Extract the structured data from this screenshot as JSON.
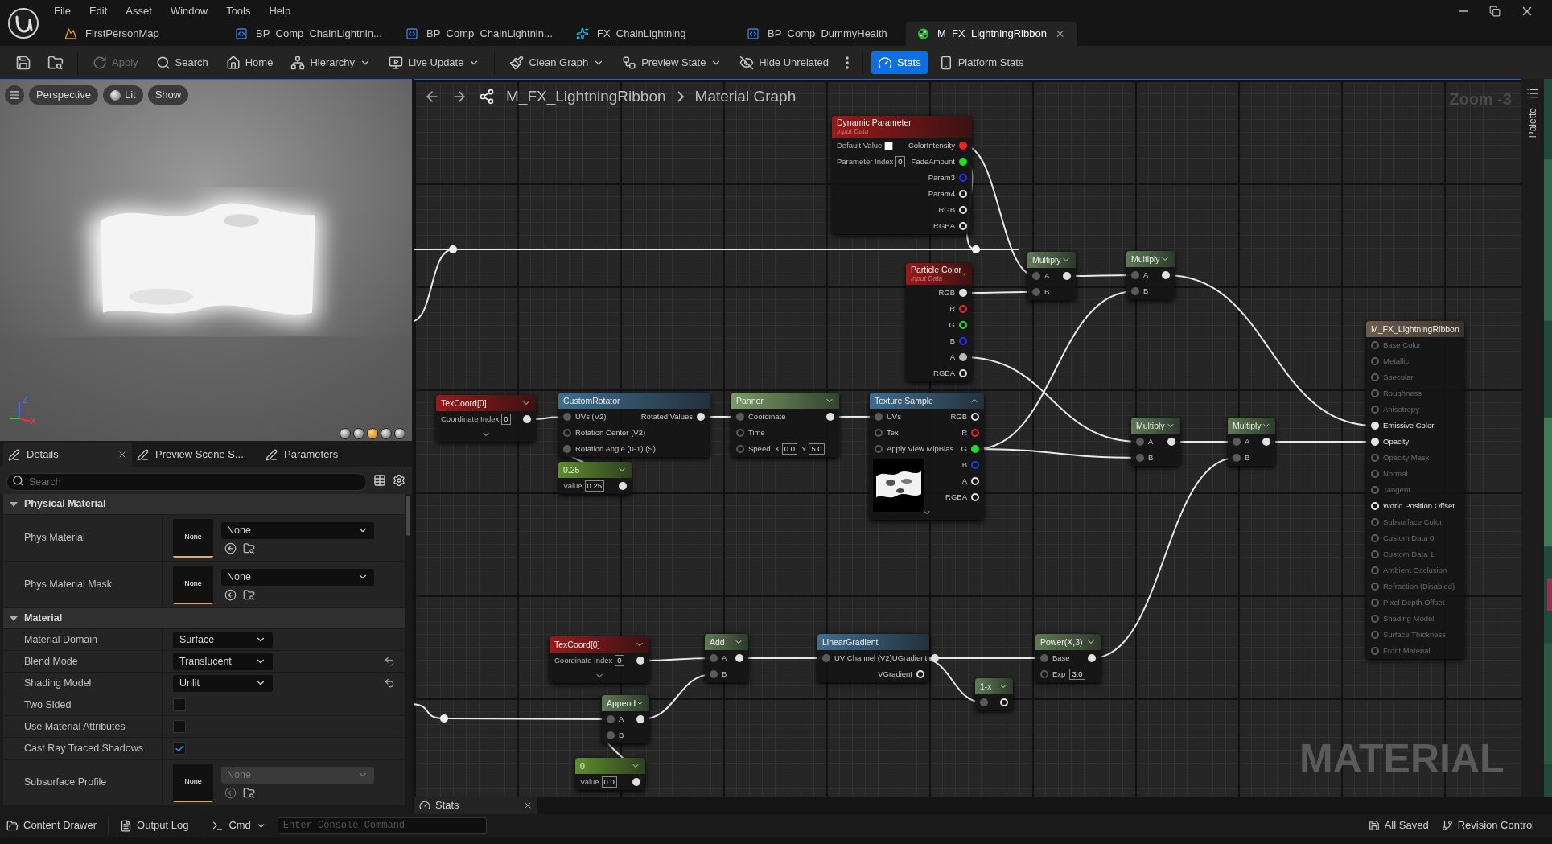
{
  "menu": [
    "File",
    "Edit",
    "Asset",
    "Window",
    "Tools",
    "Help"
  ],
  "tabs": [
    {
      "label": "FirstPersonMap",
      "kind": "level",
      "selected": false
    },
    {
      "label": "BP_Comp_ChainLightnin...",
      "kind": "blueprint",
      "selected": false
    },
    {
      "label": "BP_Comp_ChainLightnin...",
      "kind": "blueprint",
      "selected": false
    },
    {
      "label": "FX_ChainLightning",
      "kind": "niagara",
      "selected": false
    },
    {
      "label": "BP_Comp_DummyHealth",
      "kind": "blueprint",
      "selected": false
    },
    {
      "label": "M_FX_LightningRibbon",
      "kind": "material",
      "selected": true
    }
  ],
  "toolbar": [
    {
      "kind": "icon"
    },
    {
      "kind": "icon"
    },
    {
      "kind": "button",
      "label": "Apply",
      "disabled": true
    },
    {
      "kind": "button",
      "label": "Search",
      "disabled": false
    },
    {
      "kind": "button",
      "label": "Home",
      "disabled": false
    },
    {
      "kind": "dropdown",
      "label": "Hierarchy"
    },
    {
      "kind": "dropdown",
      "label": "Live Update"
    },
    {
      "kind": "dropdown",
      "label": "Clean Graph"
    },
    {
      "kind": "dropdown",
      "label": "Preview State"
    },
    {
      "kind": "button",
      "label": "Hide Unrelated",
      "disabled": false
    },
    {
      "kind": "icon"
    },
    {
      "kind": "toggle",
      "label": "Stats",
      "on": true
    },
    {
      "kind": "toggle",
      "label": "Platform Stats",
      "on": false
    }
  ],
  "viewport": {
    "buttons": [
      "Perspective",
      "Lit",
      "Show"
    ],
    "axis_labels": [
      "Z",
      "X"
    ],
    "view_modes": [
      {
        "selected": false
      },
      {
        "selected": false
      },
      {
        "selected": true
      },
      {
        "selected": false
      },
      {
        "selected": false
      }
    ]
  },
  "details": {
    "tabs": [
      {
        "label": "Details",
        "selected": true
      },
      {
        "label": "Preview Scene S...",
        "selected": false
      },
      {
        "label": "Parameters",
        "selected": false
      }
    ],
    "search": {
      "placeholder": "Search"
    },
    "sections": [
      {
        "title": "Physical Material",
        "expanded": true,
        "rows": [
          {
            "label": "Phys Material",
            "kind": "asset",
            "thumbnail": "None",
            "value": "None",
            "disabled": false
          },
          {
            "label": "Phys Material Mask",
            "kind": "asset",
            "thumbnail": "None",
            "value": "None",
            "disabled": false
          }
        ]
      },
      {
        "title": "Material",
        "expanded": true,
        "rows": [
          {
            "label": "Material Domain",
            "kind": "select",
            "value": "Surface",
            "modified": false
          },
          {
            "label": "Blend Mode",
            "kind": "select",
            "value": "Translucent",
            "modified": true
          },
          {
            "label": "Shading Model",
            "kind": "select",
            "value": "Unlit",
            "modified": true
          },
          {
            "label": "Two Sided",
            "kind": "checkbox",
            "checked": false
          },
          {
            "label": "Use Material Attributes",
            "kind": "checkbox",
            "checked": false
          },
          {
            "label": "Cast Ray Traced Shadows",
            "kind": "checkbox",
            "checked": true
          },
          {
            "label": "Subsurface Profile",
            "kind": "asset",
            "thumbnail": "None",
            "value": "None",
            "disabled": true
          }
        ]
      }
    ]
  },
  "graph": {
    "breadcrumb": {
      "asset": "M_FX_LightningRibbon",
      "graph": "Material Graph"
    },
    "zoom": "Zoom -3",
    "label": "MATERIAL",
    "palette": "Palette",
    "stats_tab": "Stats",
    "nodes": [
      {
        "kind": "input",
        "title": "Dynamic Parameter",
        "subtitle": "Input Data",
        "rows": [
          {
            "fields": [
              {
                "label": "Default Value",
                "color": "#ffffff"
              }
            ],
            "out": {
              "label": "ColorIntensity",
              "color": "#ff2020",
              "connected": true
            }
          },
          {
            "fields": [
              {
                "label": "Parameter Index",
                "value": "0"
              }
            ],
            "out": {
              "label": "FadeAmount",
              "color": "#22dd22",
              "connected": true
            }
          },
          {
            "out": {
              "label": "Param3",
              "color": "#2233ff",
              "connected": false
            }
          },
          {
            "out": {
              "label": "Param4",
              "connected": false
            }
          },
          {
            "out": {
              "label": "RGB",
              "connected": false
            }
          },
          {
            "out": {
              "label": "RGBA",
              "connected": false
            }
          }
        ]
      },
      {
        "kind": "input",
        "title": "Particle Color",
        "subtitle": "Input Data",
        "expanded": false,
        "rows": [
          {
            "out": {
              "label": "RGB",
              "connected": true
            }
          },
          {
            "out": {
              "label": "R",
              "color": "#ff2020",
              "connected": false
            }
          },
          {
            "out": {
              "label": "G",
              "color": "#22dd22",
              "connected": false
            }
          },
          {
            "out": {
              "label": "B",
              "color": "#2233ff",
              "connected": false
            }
          },
          {
            "out": {
              "label": "A",
              "color": "#bbbbbb",
              "connected": true
            }
          },
          {
            "out": {
              "label": "RGBA",
              "connected": false
            }
          }
        ]
      },
      {
        "kind": "math",
        "title": "Multiply",
        "expanded": false,
        "rows": [
          {
            "in": {
              "label": "A",
              "connected": true
            },
            "out": {
              "connected": true
            }
          },
          {
            "in": {
              "label": "B",
              "connected": true
            }
          }
        ]
      },
      {
        "kind": "math",
        "title": "Multiply",
        "expanded": false,
        "rows": [
          {
            "in": {
              "label": "A",
              "connected": true
            },
            "out": {
              "connected": true
            }
          },
          {
            "in": {
              "label": "B",
              "connected": true
            }
          }
        ]
      },
      {
        "kind": "input",
        "title": "TexCoord[0]",
        "expanded": false,
        "more_pins": true,
        "rows": [
          {
            "fields": [
              {
                "label": "Coordinate Index",
                "value": "0"
              }
            ],
            "out": {
              "connected": true
            }
          }
        ]
      },
      {
        "kind": "function",
        "title": "CustomRotator",
        "rows": [
          {
            "in": {
              "label": "UVs (V2)",
              "connected": true
            },
            "out": {
              "label": "Rotated Values",
              "connected": true
            }
          },
          {
            "in": {
              "label": "Rotation Center (V2)",
              "connected": false
            }
          },
          {
            "in": {
              "label": "Rotation Angle (0-1) (S)",
              "connected": true
            }
          }
        ]
      },
      {
        "kind": "constant",
        "title": "0.25",
        "expanded": false,
        "rows": [
          {
            "fields": [
              {
                "label": "Value",
                "value": "0.25"
              }
            ],
            "out": {
              "connected": true
            }
          }
        ]
      },
      {
        "kind": "panner",
        "title": "Panner",
        "expanded": false,
        "rows": [
          {
            "in": {
              "label": "Coordinate",
              "connected": true
            },
            "out": {
              "connected": true
            }
          },
          {
            "in": {
              "label": "Time",
              "connected": false
            }
          },
          {
            "in": {
              "label": "Speed",
              "connected": false
            },
            "fields": [
              {
                "label": "X",
                "value": "0.0"
              },
              {
                "label": "Y",
                "value": "5.0"
              }
            ]
          }
        ]
      },
      {
        "kind": "function",
        "title": "Texture Sample",
        "expanded": true,
        "more_pins": true,
        "preview": true,
        "rows": [
          {
            "in": {
              "label": "UVs",
              "connected": true
            },
            "out": {
              "label": "RGB",
              "connected": false
            }
          },
          {
            "in": {
              "label": "Tex",
              "connected": false
            },
            "out": {
              "label": "R",
              "color": "#ff2020",
              "connected": false
            }
          },
          {
            "in": {
              "label": "Apply View MipBias",
              "connected": false
            },
            "out": {
              "label": "G",
              "color": "#22dd22",
              "connected": true
            }
          },
          {
            "out": {
              "label": "B",
              "color": "#2233ff",
              "connected": false
            }
          },
          {
            "out": {
              "label": "A",
              "connected": false
            }
          },
          {
            "out": {
              "label": "RGBA",
              "connected": false
            }
          }
        ]
      },
      {
        "kind": "math",
        "title": "Multiply",
        "expanded": false,
        "rows": [
          {
            "in": {
              "label": "A",
              "connected": true
            },
            "out": {
              "connected": true
            }
          },
          {
            "in": {
              "label": "B",
              "connected": true
            }
          }
        ]
      },
      {
        "kind": "math",
        "title": "Multiply",
        "expanded": false,
        "rows": [
          {
            "in": {
              "label": "A",
              "connected": true
            },
            "out": {
              "connected": true
            }
          },
          {
            "in": {
              "label": "B",
              "connected": true
            }
          }
        ]
      },
      {
        "kind": "output",
        "title": "M_FX_LightningRibbon",
        "rows": [
          {
            "in": {
              "label": "Base Color",
              "connected": false,
              "disabled": true
            }
          },
          {
            "in": {
              "label": "Metallic",
              "connected": false,
              "disabled": true
            }
          },
          {
            "in": {
              "label": "Specular",
              "connected": false,
              "disabled": true
            }
          },
          {
            "in": {
              "label": "Roughness",
              "connected": false,
              "disabled": true
            }
          },
          {
            "in": {
              "label": "Anisotropy",
              "connected": false,
              "disabled": true
            }
          },
          {
            "in": {
              "label": "Emissive Color",
              "connected": true,
              "disabled": false
            }
          },
          {
            "in": {
              "label": "Opacity",
              "connected": true,
              "disabled": false
            }
          },
          {
            "in": {
              "label": "Opacity Mask",
              "connected": false,
              "disabled": true
            }
          },
          {
            "in": {
              "label": "Normal",
              "connected": false,
              "disabled": true
            }
          },
          {
            "in": {
              "label": "Tangent",
              "connected": false,
              "disabled": true
            }
          },
          {
            "in": {
              "label": "World Position Offset",
              "connected": false,
              "disabled": false
            }
          },
          {
            "in": {
              "label": "Subsurface Color",
              "connected": false,
              "disabled": true
            }
          },
          {
            "in": {
              "label": "Custom Data 0",
              "connected": false,
              "disabled": true
            }
          },
          {
            "in": {
              "label": "Custom Data 1",
              "connected": false,
              "disabled": true
            }
          },
          {
            "in": {
              "label": "Ambient Occlusion",
              "connected": false,
              "disabled": true
            }
          },
          {
            "in": {
              "label": "Refraction (Disabled)",
              "connected": false,
              "disabled": true
            }
          },
          {
            "in": {
              "label": "Pixel Depth Offset",
              "connected": false,
              "disabled": true
            }
          },
          {
            "in": {
              "label": "Shading Model",
              "connected": false,
              "disabled": true
            }
          },
          {
            "in": {
              "label": "Surface Thickness",
              "connected": false,
              "disabled": true
            }
          },
          {
            "in": {
              "label": "Front Material",
              "connected": false,
              "disabled": true
            }
          }
        ]
      },
      {
        "kind": "input",
        "title": "TexCoord[0]",
        "expanded": false,
        "more_pins": true,
        "rows": [
          {
            "fields": [
              {
                "label": "Coordinate Index",
                "value": "0"
              }
            ],
            "out": {
              "connected": true
            }
          }
        ]
      },
      {
        "kind": "math",
        "title": "Add",
        "expanded": false,
        "rows": [
          {
            "in": {
              "label": "A",
              "connected": true
            },
            "out": {
              "connected": true
            }
          },
          {
            "in": {
              "label": "B",
              "connected": true
            }
          }
        ]
      },
      {
        "kind": "function",
        "title": "LinearGradient",
        "rows": [
          {
            "in": {
              "label": "UV Channel (V2)",
              "connected": true
            },
            "out": {
              "label": "UGradient",
              "connected": true
            }
          },
          {
            "out": {
              "label": "VGradient",
              "connected": false
            }
          }
        ]
      },
      {
        "kind": "math",
        "title": "Power(X,3)",
        "expanded": false,
        "rows": [
          {
            "in": {
              "label": "Base",
              "connected": true
            },
            "out": {
              "connected": true
            }
          },
          {
            "in": {
              "label": "Exp",
              "connected": false
            },
            "fields": [
              {
                "value": "3.0"
              }
            ]
          }
        ]
      },
      {
        "kind": "math",
        "title": "1-x",
        "expanded": false,
        "rows": [
          {
            "in": {
              "connected": true
            },
            "out": {
              "connected": false
            }
          }
        ]
      },
      {
        "kind": "math",
        "title": "Append",
        "expanded": false,
        "rows": [
          {
            "in": {
              "label": "A",
              "connected": true
            },
            "out": {
              "connected": true
            }
          },
          {
            "in": {
              "label": "B",
              "connected": true
            }
          }
        ]
      },
      {
        "kind": "constant",
        "title": "0",
        "expanded": false,
        "rows": [
          {
            "fields": [
              {
                "label": "Value",
                "value": "0.0"
              }
            ],
            "out": {
              "connected": true
            }
          }
        ]
      }
    ]
  },
  "status_bar": {
    "content_drawer": "Content Drawer",
    "output_log": "Output Log",
    "cmd": "Cmd",
    "console_placeholder": "Enter Console Command",
    "saved": "All Saved",
    "revision": "Revision Control"
  }
}
